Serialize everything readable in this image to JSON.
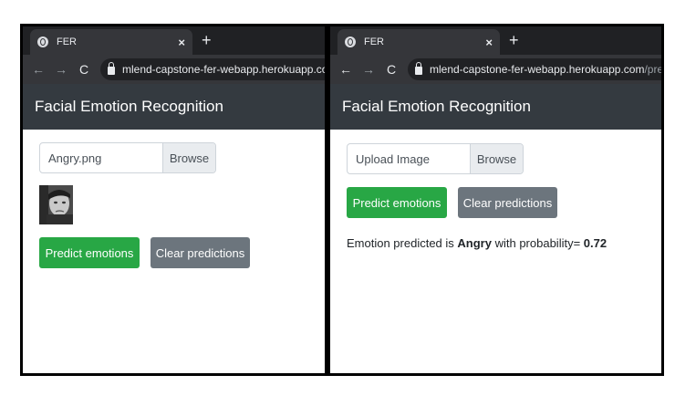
{
  "left": {
    "tab_title": "FER",
    "url_host": "mlend-capstone-fer-webapp.herokuapp.com",
    "url_path": "",
    "brand": "Facial Emotion Recognition",
    "file_name": "Angry.png",
    "browse_label": "Browse",
    "predict_label": "Predict emotions",
    "clear_label": "Clear predictions"
  },
  "right": {
    "tab_title": "FER",
    "url_host": "mlend-capstone-fer-webapp.herokuapp.com",
    "url_path": "/predict",
    "brand": "Facial Emotion Recognition",
    "file_placeholder": "Upload Image",
    "browse_label": "Browse",
    "predict_label": "Predict emotions",
    "clear_label": "Clear predictions",
    "result_prefix": "Emotion predicted is",
    "result_emotion": "Angry",
    "result_mid": "with probability=",
    "result_probability": "0.72"
  },
  "chrome": {
    "close_icon": "×",
    "newtab_icon": "+",
    "back_icon": "←",
    "forward_icon": "→",
    "reload_icon": "C"
  },
  "colors": {
    "success": "#28a745",
    "secondary": "#6c757d",
    "navbar": "#343a40"
  }
}
